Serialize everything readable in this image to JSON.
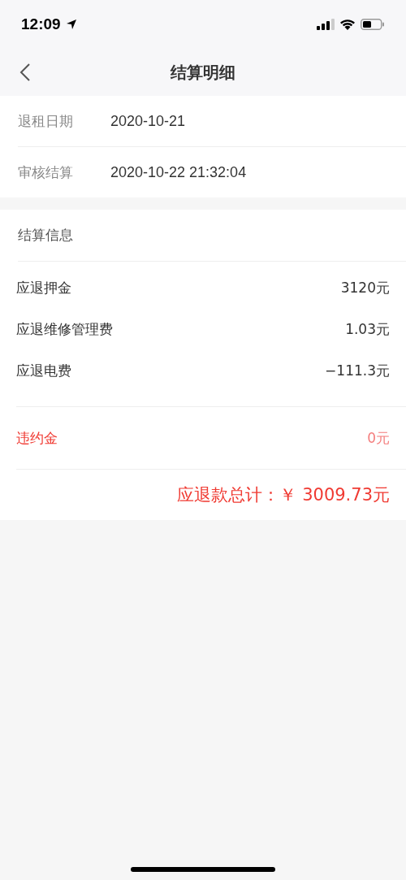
{
  "status_bar": {
    "time": "12:09"
  },
  "nav": {
    "title": "结算明细"
  },
  "details": [
    {
      "label": "退租日期",
      "value": "2020-10-21"
    },
    {
      "label": "审核结算",
      "value": "2020-10-22 21:32:04"
    }
  ],
  "settlement": {
    "title": "结算信息",
    "items": [
      {
        "label": "应退押金",
        "value": "3120元"
      },
      {
        "label": "应退维修管理费",
        "value": "1.03元"
      },
      {
        "label": "应退电费",
        "value": "−111.3元"
      }
    ],
    "penalty": {
      "label": "违约金",
      "value": "0元"
    },
    "total": "应退款总计：￥ 3009.73元"
  }
}
